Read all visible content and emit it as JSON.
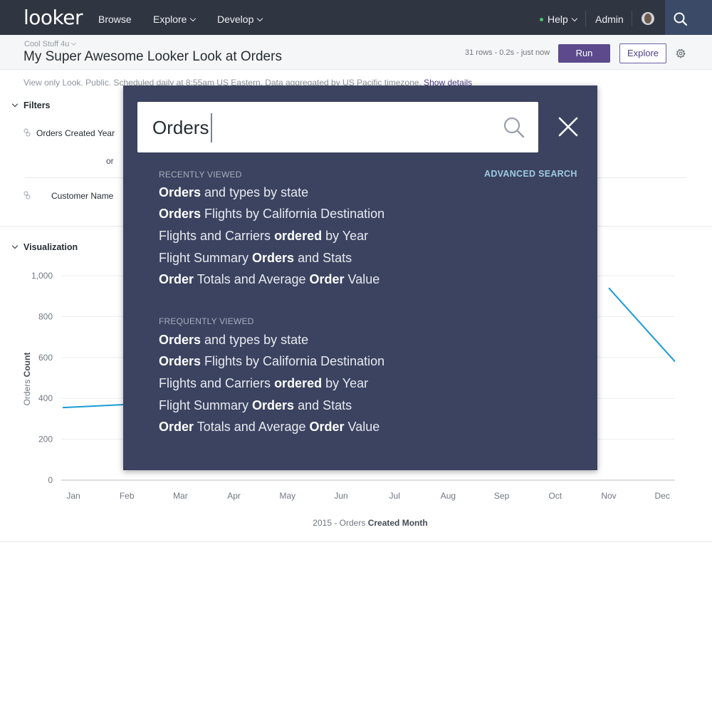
{
  "nav": {
    "logo": "looker",
    "items": [
      {
        "label": "Browse"
      },
      {
        "label": "Explore"
      },
      {
        "label": "Develop"
      }
    ],
    "help_label": "Help",
    "admin_label": "Admin"
  },
  "look": {
    "folder": "Cool Stuff 4u",
    "title": "My Super Awesome Looker Look at Orders",
    "run_meta": "31 rows - 0.2s - just now",
    "run_label": "Run",
    "explore_label": "Explore",
    "description": "View only Look. Public. Scheduled daily at 8:55am US Eastern. Data aggregated by US Pacific timezone.",
    "show_details": "Show details"
  },
  "filters": {
    "heading": "Filters",
    "items": [
      {
        "label": "Orders Created Year"
      },
      {
        "label": "Customer Name"
      }
    ],
    "or_label": "or"
  },
  "visualization": {
    "heading": "Visualization"
  },
  "chart_data": {
    "type": "line",
    "categories": [
      "Jan",
      "Feb",
      "Mar",
      "Apr",
      "May",
      "Jun",
      "Jul",
      "Aug",
      "Sep",
      "Oct",
      "Nov",
      "Dec"
    ],
    "series": [
      {
        "values": [
          355,
          370,
          null,
          null,
          null,
          null,
          null,
          null,
          null,
          null,
          940,
          580
        ]
      }
    ],
    "yticks": [
      "0",
      "200",
      "400",
      "600",
      "800",
      "1,000"
    ],
    "ylim": [
      0,
      1000
    ],
    "ylabel_light": "Orders",
    "ylabel_bold": "Count",
    "xlabel_light": "2015 - Orders",
    "xlabel_bold": "Created Month",
    "grid": true,
    "line_color": "#1a9bd7"
  },
  "search": {
    "query": "Orders",
    "advanced_label": "ADVANCED SEARCH",
    "groups": [
      {
        "heading": "RECENTLY VIEWED",
        "results": [
          {
            "bold": "Orders",
            "rest": " and types by state"
          },
          {
            "bold": "Orders",
            "rest": " Flights by California Destination"
          },
          {
            "pre": "Flights and Carriers ",
            "bold": "ordered",
            "rest": " by Year"
          },
          {
            "pre": "Flight Summary ",
            "bold": "Orders",
            "rest": " and Stats"
          },
          {
            "bold": "Order",
            "mid": " Totals and Average ",
            "bold2": "Order",
            "rest": " Value"
          }
        ]
      },
      {
        "heading": "FREQUENTLY VIEWED",
        "results": [
          {
            "bold": "Orders",
            "rest": " and types by state"
          },
          {
            "bold": "Orders",
            "rest": " Flights by California Destination"
          },
          {
            "pre": "Flights and Carriers ",
            "bold": "ordered",
            "rest": " by Year"
          },
          {
            "pre": "Flight Summary ",
            "bold": "Orders",
            "rest": " and Stats"
          },
          {
            "bold": "Order",
            "mid": " Totals and Average ",
            "bold2": "Order",
            "rest": " Value"
          }
        ]
      }
    ]
  }
}
